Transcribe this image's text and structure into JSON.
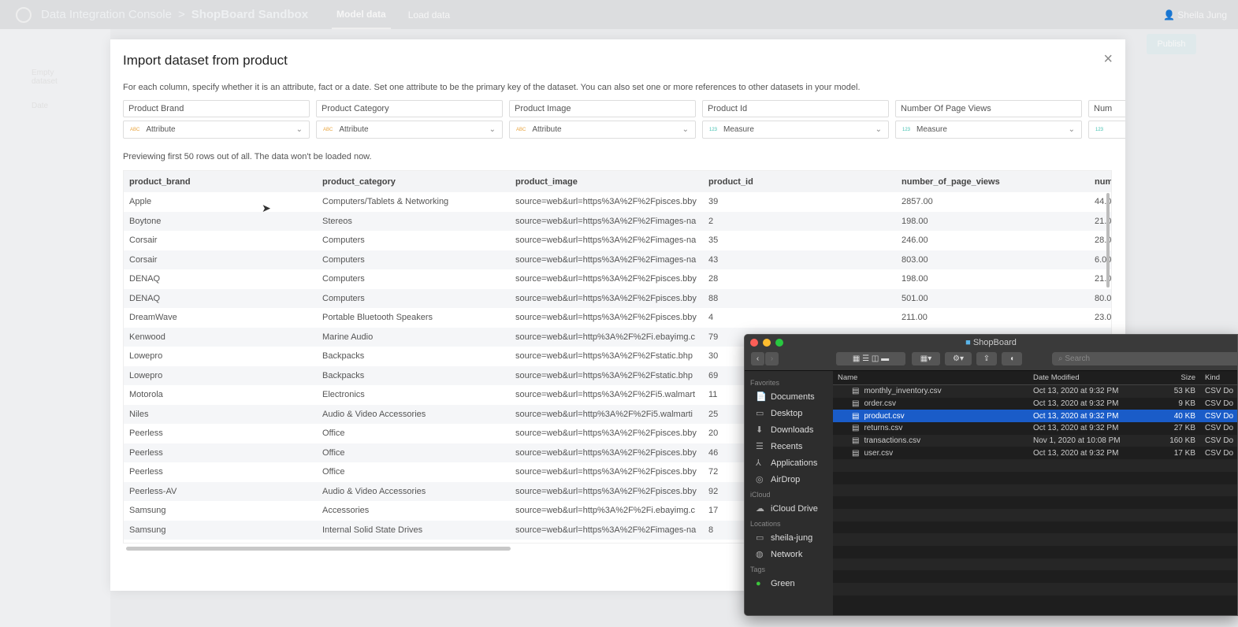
{
  "topbar": {
    "app": "Data Integration Console",
    "separator": ">",
    "project": "ShopBoard Sandbox",
    "tabs": [
      "Model data",
      "Load data"
    ],
    "user": "Sheila Jung"
  },
  "sidebar": {
    "items": [
      "Empty dataset",
      "Date"
    ]
  },
  "publish": "Publish",
  "modal": {
    "title": "Import dataset from product",
    "close": "×",
    "description": "For each column, specify whether it is an attribute, fact or a date. Set one attribute to be the primary key of the dataset. You can also set one or more references to other datasets in your model.",
    "columns": [
      {
        "name": "Product Brand",
        "type": "Attribute",
        "icon": "ABC"
      },
      {
        "name": "Product Category",
        "type": "Attribute",
        "icon": "ABC"
      },
      {
        "name": "Product Image",
        "type": "Attribute",
        "icon": "ABC"
      },
      {
        "name": "Product Id",
        "type": "Measure",
        "icon": "123"
      },
      {
        "name": "Number Of Page Views",
        "type": "Measure",
        "icon": "123"
      },
      {
        "name": "Num",
        "type": "",
        "icon": "123"
      }
    ],
    "preview_note": "Previewing first 50 rows out of all. The data won't be loaded now.",
    "headers": [
      "product_brand",
      "product_category",
      "product_image",
      "product_id",
      "number_of_page_views",
      "num"
    ],
    "rows": [
      [
        "Apple",
        "Computers/Tablets & Networking",
        "source=web&url=https%3A%2F%2Fpisces.bby",
        "39",
        "2857.00",
        "44.0"
      ],
      [
        "Boytone",
        "Stereos",
        "source=web&url=https%3A%2F%2Fimages-na",
        "2",
        "198.00",
        "21.0"
      ],
      [
        "Corsair",
        "Computers",
        "source=web&url=https%3A%2F%2Fimages-na",
        "35",
        "246.00",
        "28.0"
      ],
      [
        "Corsair",
        "Computers",
        "source=web&url=https%3A%2F%2Fimages-na",
        "43",
        "803.00",
        "6.00"
      ],
      [
        "DENAQ",
        "Computers",
        "source=web&url=https%3A%2F%2Fpisces.bby",
        "28",
        "198.00",
        "21.0"
      ],
      [
        "DENAQ",
        "Computers",
        "source=web&url=https%3A%2F%2Fpisces.bby",
        "88",
        "501.00",
        "80.0"
      ],
      [
        "DreamWave",
        "Portable Bluetooth Speakers",
        "source=web&url=https%3A%2F%2Fpisces.bby",
        "4",
        "211.00",
        "23.0"
      ],
      [
        "Kenwood",
        "Marine Audio",
        "source=web&url=http%3A%2F%2Fi.ebayimg.c",
        "79",
        "",
        ""
      ],
      [
        "Lowepro",
        "Backpacks",
        "source=web&url=https%3A%2F%2Fstatic.bhp",
        "30",
        "",
        ""
      ],
      [
        "Lowepro",
        "Backpacks",
        "source=web&url=https%3A%2F%2Fstatic.bhp",
        "69",
        "",
        ""
      ],
      [
        "Motorola",
        "Electronics",
        "source=web&url=https%3A%2F%2Fi5.walmart",
        "11",
        "",
        ""
      ],
      [
        "Niles",
        "Audio & Video Accessories",
        "source=web&url=http%3A%2F%2Fi5.walmarti",
        "25",
        "",
        ""
      ],
      [
        "Peerless",
        "Office",
        "source=web&url=https%3A%2F%2Fpisces.bby",
        "20",
        "",
        ""
      ],
      [
        "Peerless",
        "Office",
        "source=web&url=https%3A%2F%2Fpisces.bby",
        "46",
        "",
        ""
      ],
      [
        "Peerless",
        "Office",
        "source=web&url=https%3A%2F%2Fpisces.bby",
        "72",
        "",
        ""
      ],
      [
        "Peerless-AV",
        "Audio & Video Accessories",
        "source=web&url=https%3A%2F%2Fpisces.bby",
        "92",
        "",
        ""
      ],
      [
        "Samsung",
        "Accessories",
        "source=web&url=http%3A%2F%2Fi.ebayimg.c",
        "17",
        "",
        ""
      ],
      [
        "Samsung",
        "Internal Solid State Drives",
        "source=web&url=https%3A%2F%2Fimages-na",
        "8",
        "",
        ""
      ]
    ]
  },
  "finder": {
    "title": "ShopBoard",
    "search_placeholder": "Search",
    "sidebar": [
      {
        "section": "Favorites",
        "items": [
          {
            "label": "Documents",
            "icon": "📄"
          },
          {
            "label": "Desktop",
            "icon": "▭"
          },
          {
            "label": "Downloads",
            "icon": "⬇"
          },
          {
            "label": "Recents",
            "icon": "☰"
          },
          {
            "label": "Applications",
            "icon": "⅄"
          },
          {
            "label": "AirDrop",
            "icon": "◎"
          }
        ]
      },
      {
        "section": "iCloud",
        "items": [
          {
            "label": "iCloud Drive",
            "icon": "☁"
          }
        ]
      },
      {
        "section": "Locations",
        "items": [
          {
            "label": "sheila-jung",
            "icon": "▭"
          },
          {
            "label": "Network",
            "icon": "◍"
          }
        ]
      },
      {
        "section": "Tags",
        "items": [
          {
            "label": "Green",
            "icon": "●"
          }
        ]
      }
    ],
    "headers": [
      "Name",
      "Date Modified",
      "Size",
      "Kind"
    ],
    "files": [
      {
        "name": "monthly_inventory.csv",
        "date": "Oct 13, 2020 at 9:32 PM",
        "size": "53 KB",
        "kind": "CSV Do"
      },
      {
        "name": "order.csv",
        "date": "Oct 13, 2020 at 9:32 PM",
        "size": "9 KB",
        "kind": "CSV Do"
      },
      {
        "name": "product.csv",
        "date": "Oct 13, 2020 at 9:32 PM",
        "size": "40 KB",
        "kind": "CSV Do",
        "selected": true
      },
      {
        "name": "returns.csv",
        "date": "Oct 13, 2020 at 9:32 PM",
        "size": "27 KB",
        "kind": "CSV Do"
      },
      {
        "name": "transactions.csv",
        "date": "Nov 1, 2020 at 10:08 PM",
        "size": "160 KB",
        "kind": "CSV Do"
      },
      {
        "name": "user.csv",
        "date": "Oct 13, 2020 at 9:32 PM",
        "size": "17 KB",
        "kind": "CSV Do"
      }
    ]
  },
  "colors": {
    "attribute_icon": "#e8a33c",
    "measure_icon": "#3cbfae",
    "selection": "#1a5cc8"
  }
}
